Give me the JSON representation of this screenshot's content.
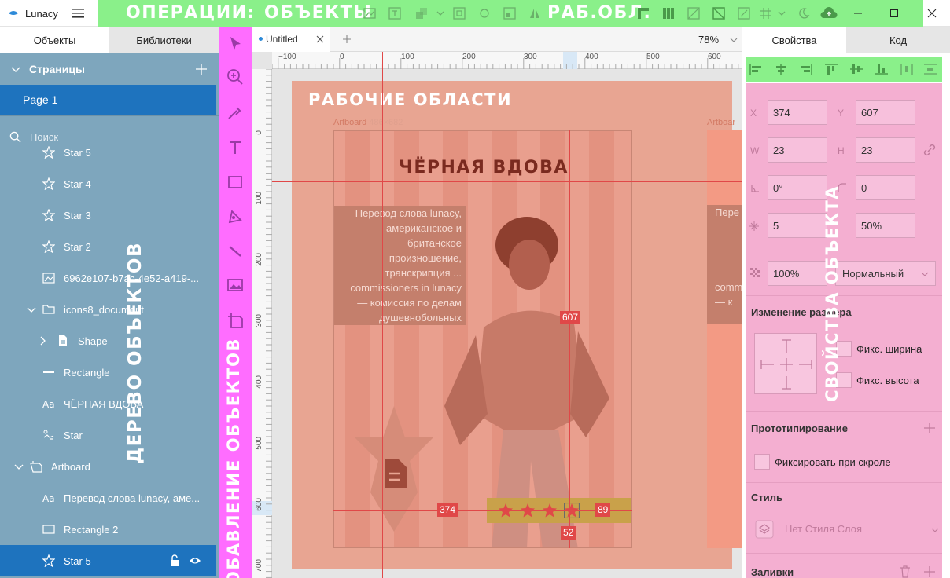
{
  "app": {
    "name": "Lunacy"
  },
  "annotations": {
    "operations": "ОПЕРАЦИИ:",
    "objects": "ОБЪЕКТЫ",
    "workspace": "РАБ.ОБЛ.",
    "object_tree": "ДЕРЕВО ОБЪЕКТОВ",
    "add_objects": "ДОБАВЛЕНИЕ ОБЪЕКТОВ",
    "artboards": "РАБОЧИЕ ОБЛАСТИ",
    "object_props": "СВОЙСТВА ОБЪЕКТА"
  },
  "left_tabs": {
    "objects": "Объекты",
    "libraries": "Библиотеки"
  },
  "pages": {
    "header": "Страницы",
    "items": [
      "Page 1"
    ]
  },
  "search": {
    "placeholder": "Поиск"
  },
  "tree": [
    {
      "label": "Star 5",
      "icon": "star-icon",
      "indent": 1
    },
    {
      "label": "Star 4",
      "icon": "star-icon",
      "indent": 1
    },
    {
      "label": "Star 3",
      "icon": "star-icon",
      "indent": 1
    },
    {
      "label": "Star 2",
      "icon": "star-icon",
      "indent": 1
    },
    {
      "label": "6962e107-b7ac-4e52-a419-...",
      "icon": "image-icon",
      "indent": 1
    },
    {
      "label": "icons8_document",
      "icon": "folder-icon",
      "indent": 1
    },
    {
      "label": "Shape",
      "icon": "document-icon",
      "indent": 2
    },
    {
      "label": "Rectangle",
      "icon": "line-icon",
      "indent": 1
    },
    {
      "label": "ЧЁРНАЯ  ВДОВА",
      "icon": "text-icon",
      "indent": 1
    },
    {
      "label": "Star",
      "icon": "star-shape-icon",
      "indent": 1
    },
    {
      "label": "Artboard",
      "icon": "artboard-icon",
      "indent": 0
    },
    {
      "label": "Перевод слова lunacy, аме...",
      "icon": "text-icon",
      "indent": 1
    },
    {
      "label": "Rectangle 2",
      "icon": "rectangle-icon",
      "indent": 1
    },
    {
      "label": "Star 5",
      "icon": "star-icon",
      "indent": 1,
      "selected": true
    }
  ],
  "document": {
    "tab": "Untitled",
    "zoom": "78%"
  },
  "ruler": {
    "h_labels": [
      "−100",
      "0",
      "100",
      "200",
      "300",
      "400",
      "500",
      "600"
    ],
    "v_labels": [
      "0",
      "100",
      "200",
      "300",
      "400",
      "500",
      "600",
      "700"
    ]
  },
  "artboard": {
    "label": "Artboard",
    "size": "486×682",
    "label2": "Artboar",
    "heading": "ЧЁРНАЯ  ВДОВА",
    "paragraph": [
      "Перевод слова lunacy,",
      "американское и",
      "британское",
      "произношение,",
      "транскрипция ...",
      "commissioners in lunacy",
      "— комиссия по делам",
      "душевнобольных"
    ],
    "paragraph2": [
      "Пере",
      "",
      "",
      "",
      "",
      "comm",
      "— к",
      ""
    ],
    "measure_top": "607",
    "measure_left": "374",
    "measure_right": "89",
    "measure_bottom": "52"
  },
  "right_tabs": {
    "properties": "Свойства",
    "code": "Код"
  },
  "props": {
    "x_label": "X",
    "x": "374",
    "y_label": "Y",
    "y": "607",
    "w_label": "W",
    "w": "23",
    "h_label": "H",
    "h": "23",
    "rotation": "0°",
    "radius": "0",
    "points": "5",
    "ratio": "50%",
    "opacity": "100%",
    "blend": "Нормальный",
    "resize_title": "Изменение размера",
    "fix_width": "Фикс. ширина",
    "fix_height": "Фикс. высота",
    "prototyping_title": "Прототипирование",
    "fix_on_scroll": "Фиксировать при скроле",
    "style_title": "Стиль",
    "style_value": "Нет Стиля Слоя",
    "fills_title": "Заливки"
  },
  "colors": {
    "ops_bar": "#8af08a",
    "tree_panel": "#7ea6bd",
    "tools_bar": "#ff6dff",
    "artboards_overlay": "#e8a592",
    "props_panel": "#f4afd1",
    "selection": "#1e73be",
    "measure": "#e04848",
    "stars_bar": "#c9a14a"
  }
}
